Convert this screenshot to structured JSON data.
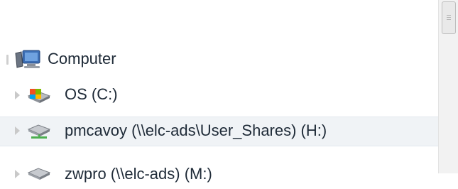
{
  "tree": {
    "items": [
      {
        "label": "Computer",
        "icon": "computer-icon",
        "expanded": true
      },
      {
        "label": "OS (C:)",
        "icon": "drive-icon",
        "expanded": false
      },
      {
        "label": "pmcavoy (\\\\elc-ads\\User_Shares) (H:)",
        "icon": "network-drive-icon",
        "expanded": false,
        "selected": true
      },
      {
        "label": "zwpro (\\\\elc-ads) (M:)",
        "icon": "network-drive-icon",
        "expanded": false
      }
    ]
  },
  "colors": {
    "selected_row": "#f0f3f6",
    "text": "#1e2a37",
    "expander": "#c9c9c9"
  }
}
